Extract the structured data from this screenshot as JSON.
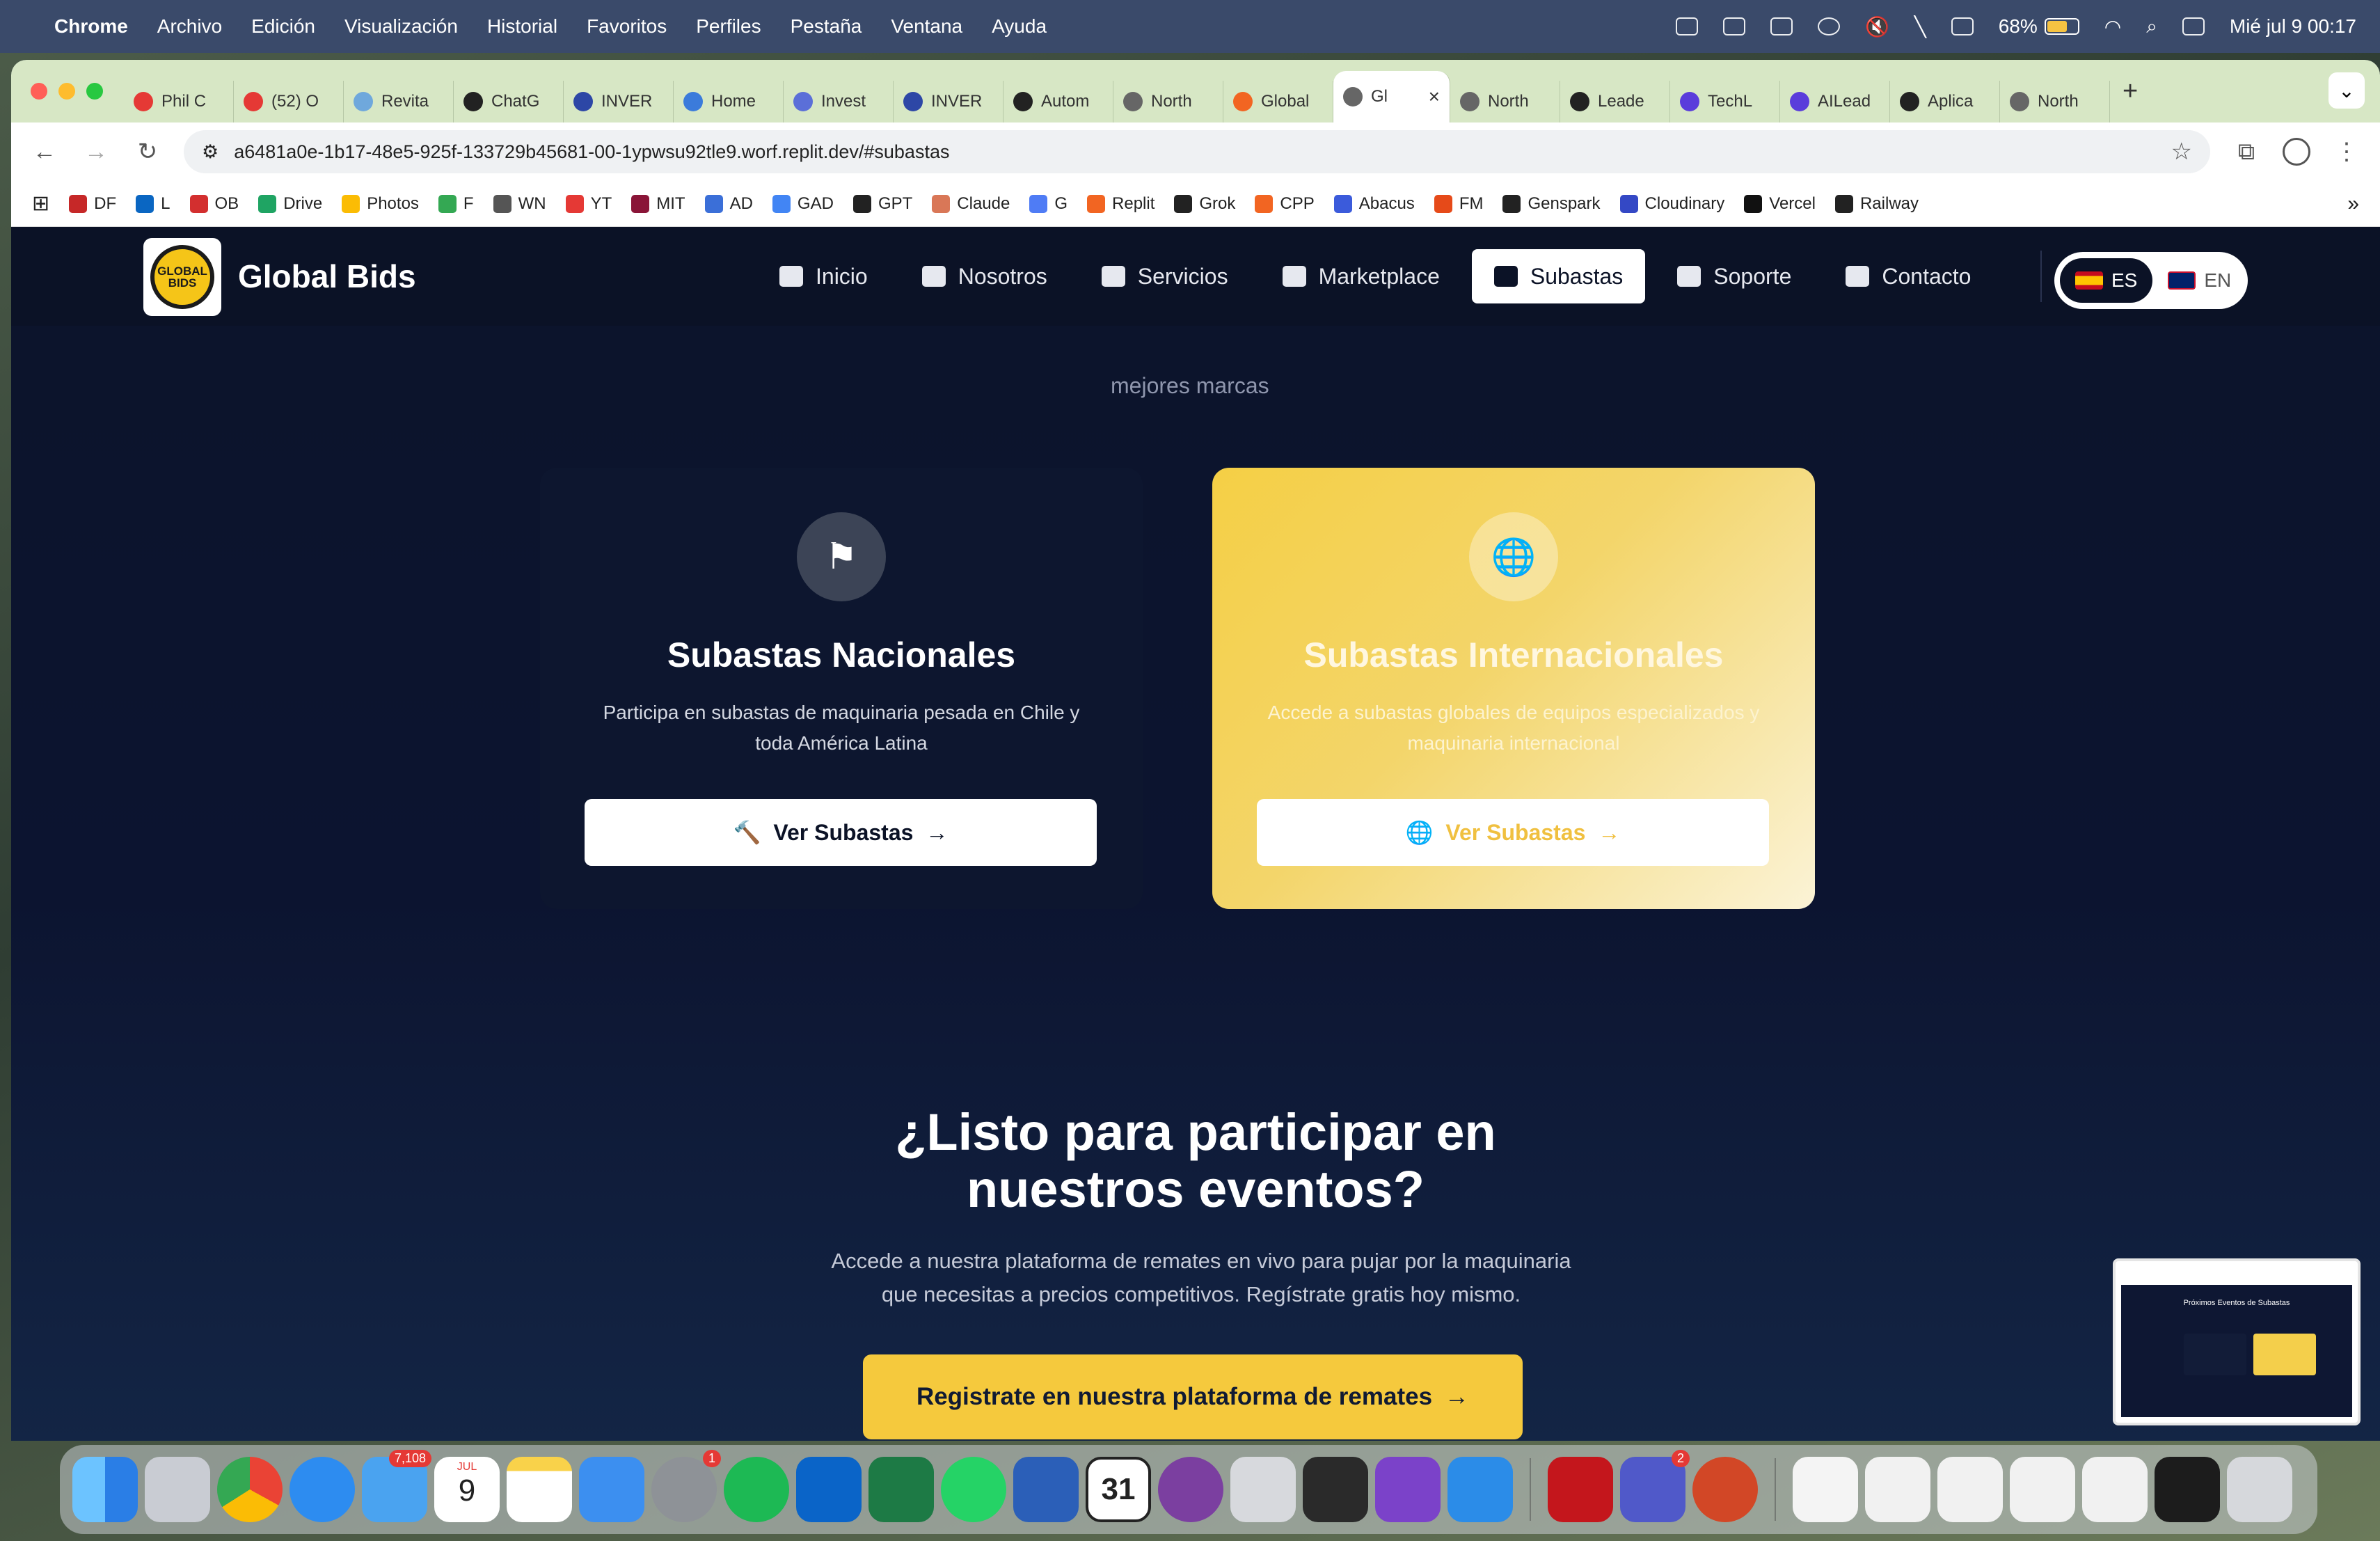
{
  "menubar": {
    "app": "Chrome",
    "items": [
      "Archivo",
      "Edición",
      "Visualización",
      "Historial",
      "Favoritos",
      "Perfiles",
      "Pestaña",
      "Ventana",
      "Ayuda"
    ],
    "battery": "68%",
    "battery_level": 0.68,
    "datetime": "Mié jul 9  00:17"
  },
  "tabs": [
    {
      "label": "Phil C",
      "color": "#e53935"
    },
    {
      "label": "(52) O",
      "color": "#e53935"
    },
    {
      "label": "Revita",
      "color": "#6fa8dc"
    },
    {
      "label": "ChatG",
      "color": "#222222"
    },
    {
      "label": "INVER",
      "color": "#2d47a6"
    },
    {
      "label": "Home",
      "color": "#3b7bdb"
    },
    {
      "label": "Invest",
      "color": "#5b6fd8"
    },
    {
      "label": "INVER",
      "color": "#2d47a6"
    },
    {
      "label": "Autom",
      "color": "#222222"
    },
    {
      "label": "North",
      "color": "#666666"
    },
    {
      "label": "Global",
      "color": "#f26522"
    },
    {
      "label": "Gl",
      "color": "#666666",
      "active": true
    },
    {
      "label": "North",
      "color": "#666666"
    },
    {
      "label": "Leade",
      "color": "#222222"
    },
    {
      "label": "TechL",
      "color": "#5a3ddb"
    },
    {
      "label": "AILead",
      "color": "#5a3ddb"
    },
    {
      "label": "Aplica",
      "color": "#222222"
    },
    {
      "label": "North",
      "color": "#666666"
    }
  ],
  "toolbar": {
    "url": "a6481a0e-1b17-48e5-925f-133729b45681-00-1ypwsu92tle9.worf.replit.dev/#subastas"
  },
  "bookmarks": [
    {
      "label": "DF",
      "color": "#c62828"
    },
    {
      "label": "L",
      "color": "#0a66c2"
    },
    {
      "label": "OB",
      "color": "#d32f2f"
    },
    {
      "label": "Drive",
      "color": "#1fa463"
    },
    {
      "label": "Photos",
      "color": "#fbbc04"
    },
    {
      "label": "F",
      "color": "#34a853"
    },
    {
      "label": "WN",
      "color": "#555555"
    },
    {
      "label": "YT",
      "color": "#e53935"
    },
    {
      "label": "MIT",
      "color": "#8a1538"
    },
    {
      "label": "AD",
      "color": "#3b6fd8"
    },
    {
      "label": "GAD",
      "color": "#4285f4"
    },
    {
      "label": "GPT",
      "color": "#222222"
    },
    {
      "label": "Claude",
      "color": "#d97757"
    },
    {
      "label": "G",
      "color": "#4f7cf5"
    },
    {
      "label": "Replit",
      "color": "#f26522"
    },
    {
      "label": "Grok",
      "color": "#222222"
    },
    {
      "label": "CPP",
      "color": "#f26522"
    },
    {
      "label": "Abacus",
      "color": "#3b5bdb"
    },
    {
      "label": "FM",
      "color": "#e64a19"
    },
    {
      "label": "Genspark",
      "color": "#222222"
    },
    {
      "label": "Cloudinary",
      "color": "#3448c5"
    },
    {
      "label": "Vercel",
      "color": "#111111"
    },
    {
      "label": "Railway",
      "color": "#222222"
    }
  ],
  "site": {
    "brand": "Global Bids",
    "logo_text": "GLOBAL BIDS",
    "nav": [
      {
        "label": "Inicio",
        "icon": "home-icon"
      },
      {
        "label": "Nosotros",
        "icon": "users-icon"
      },
      {
        "label": "Servicios",
        "icon": "wrench-icon"
      },
      {
        "label": "Marketplace",
        "icon": "grid-icon"
      },
      {
        "label": "Subastas",
        "icon": "gavel-icon",
        "active": true
      },
      {
        "label": "Soporte",
        "icon": "headset-icon"
      },
      {
        "label": "Contacto",
        "icon": "envelope-icon"
      }
    ],
    "lang": {
      "es": "ES",
      "en": "EN",
      "active": "ES"
    },
    "faded_text": "mejores marcas",
    "cards": {
      "national": {
        "title": "Subastas Nacionales",
        "description": "Participa en subastas de maquinaria pesada en Chile y toda América Latina",
        "button": "Ver Subastas"
      },
      "international": {
        "title": "Subastas Internacionales",
        "description": "Accede a subastas globales de equipos especializados y maquinaria internacional",
        "button": "Ver Subastas"
      }
    },
    "cta": {
      "title_line1": "¿Listo para participar en",
      "title_line2": "nuestros eventos?",
      "text_line1": "Accede a nuestra plataforma de remates en vivo para pujar por la maquinaria",
      "text_line2": "que necesitas a precios competitivos. Regístrate gratis hoy mismo.",
      "button": "Registrate en nuestra plataforma de remates"
    }
  },
  "thumbnail": {
    "title": "Próximos Eventos de Subastas"
  },
  "dock": {
    "badges": {
      "mail": "7,108",
      "settings": "1",
      "teams": "2"
    },
    "calendar": {
      "month": "JUL",
      "day": "9"
    },
    "calendar2_day": "31"
  }
}
